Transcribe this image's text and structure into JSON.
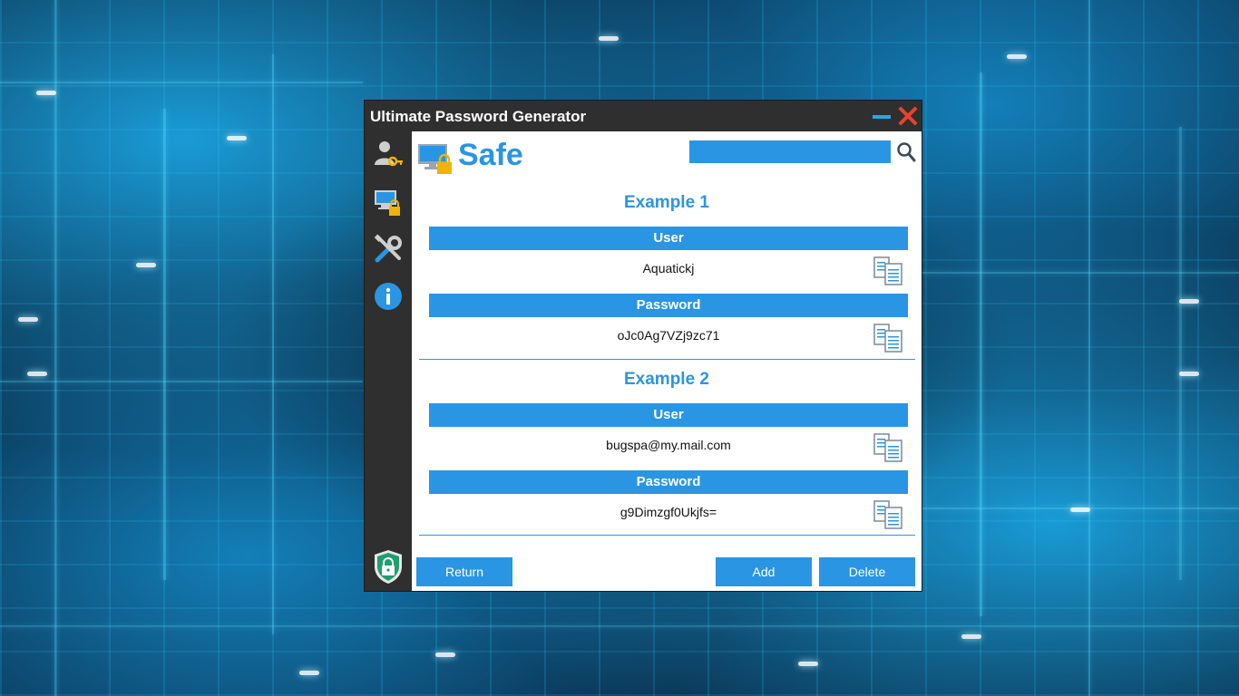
{
  "window": {
    "title": "Ultimate Password Generator"
  },
  "sidebar": {
    "items": [
      {
        "icon": "user-key-icon"
      },
      {
        "icon": "monitor-lock-icon"
      },
      {
        "icon": "tools-icon"
      },
      {
        "icon": "info-icon"
      }
    ],
    "footer_icon": "shield-lock-icon"
  },
  "header": {
    "title": "Safe",
    "search": {
      "value": "",
      "placeholder": ""
    }
  },
  "entries": [
    {
      "title": "Example 1",
      "user_label": "User",
      "user_value": "Aquatickj",
      "password_label": "Password",
      "password_value": "oJc0Ag7VZj9zc71"
    },
    {
      "title": "Example 2",
      "user_label": "User",
      "user_value": "bugspa@my.mail.com",
      "password_label": "Password",
      "password_value": "g9Dimzgf0Ukjfs="
    }
  ],
  "buttons": {
    "return": "Return",
    "add": "Add",
    "delete": "Delete"
  },
  "colors": {
    "accent": "#2a95e3",
    "window_dark": "#2f2f2f",
    "close": "#e8432e"
  }
}
